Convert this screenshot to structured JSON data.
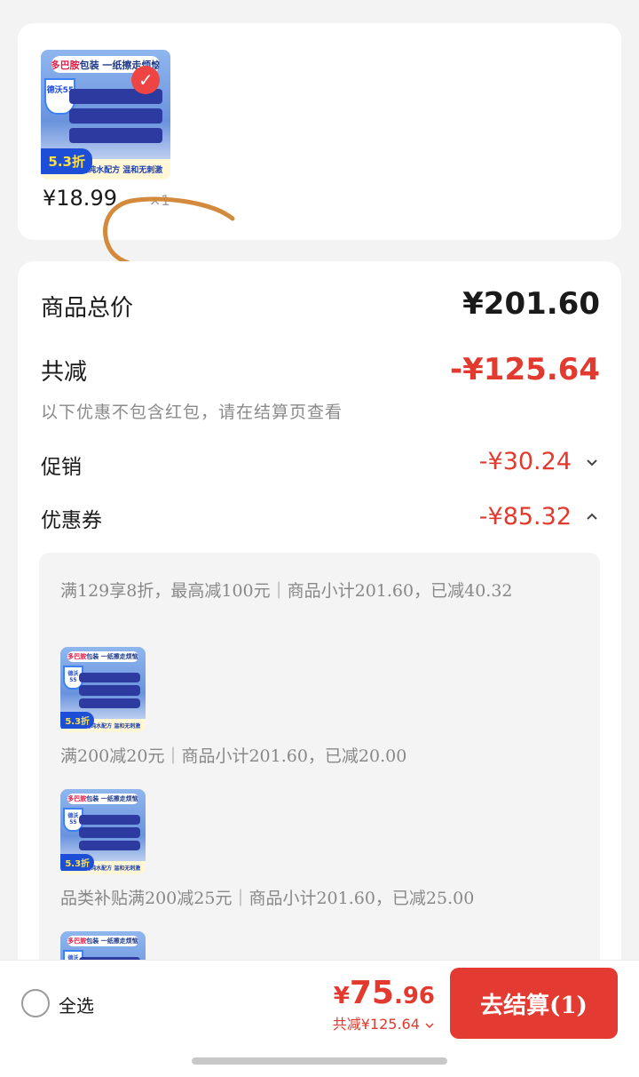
{
  "product": {
    "image_banner_brand": "多巴胺",
    "image_banner_text": "包装 一纸擦走烦恼",
    "image_badge": "德沃55",
    "image_discount": "5.3折",
    "image_bottom": "超净化纯水配方 温和无刺激",
    "unit_price": "¥18.99",
    "quantity": "×1"
  },
  "summary": {
    "total_label": "商品总价",
    "total_value": "¥201.60",
    "saved_label": "共减",
    "saved_value": "-¥125.64",
    "note": "以下优惠不包含红包，请在结算页查看",
    "promo_label": "促销",
    "promo_value": "-¥30.24",
    "coupon_label": "优惠券",
    "coupon_value": "-¥85.32"
  },
  "coupons": [
    {
      "text": "满129享8折，最高减100元｜商品小计201.60，已减40.32"
    },
    {
      "text": "满200减20元｜商品小计201.60，已减20.00"
    },
    {
      "text": "品类补贴满200减25元｜商品小计201.60，已减25.00"
    }
  ],
  "bottom": {
    "select_all": "全选",
    "price_yen": "¥",
    "price_int": "75",
    "price_dec": ".96",
    "total_discount": "共减¥125.64",
    "checkout": "去结算(1)"
  },
  "colors": {
    "accent_red": "#e23a2e",
    "scribble": "#d48a3c"
  },
  "icons": {
    "promo_toggle": "chevron-down-icon",
    "coupon_toggle": "chevron-up-icon",
    "discount_detail": "chevron-down-icon",
    "select_all": "radio-unchecked-icon"
  }
}
